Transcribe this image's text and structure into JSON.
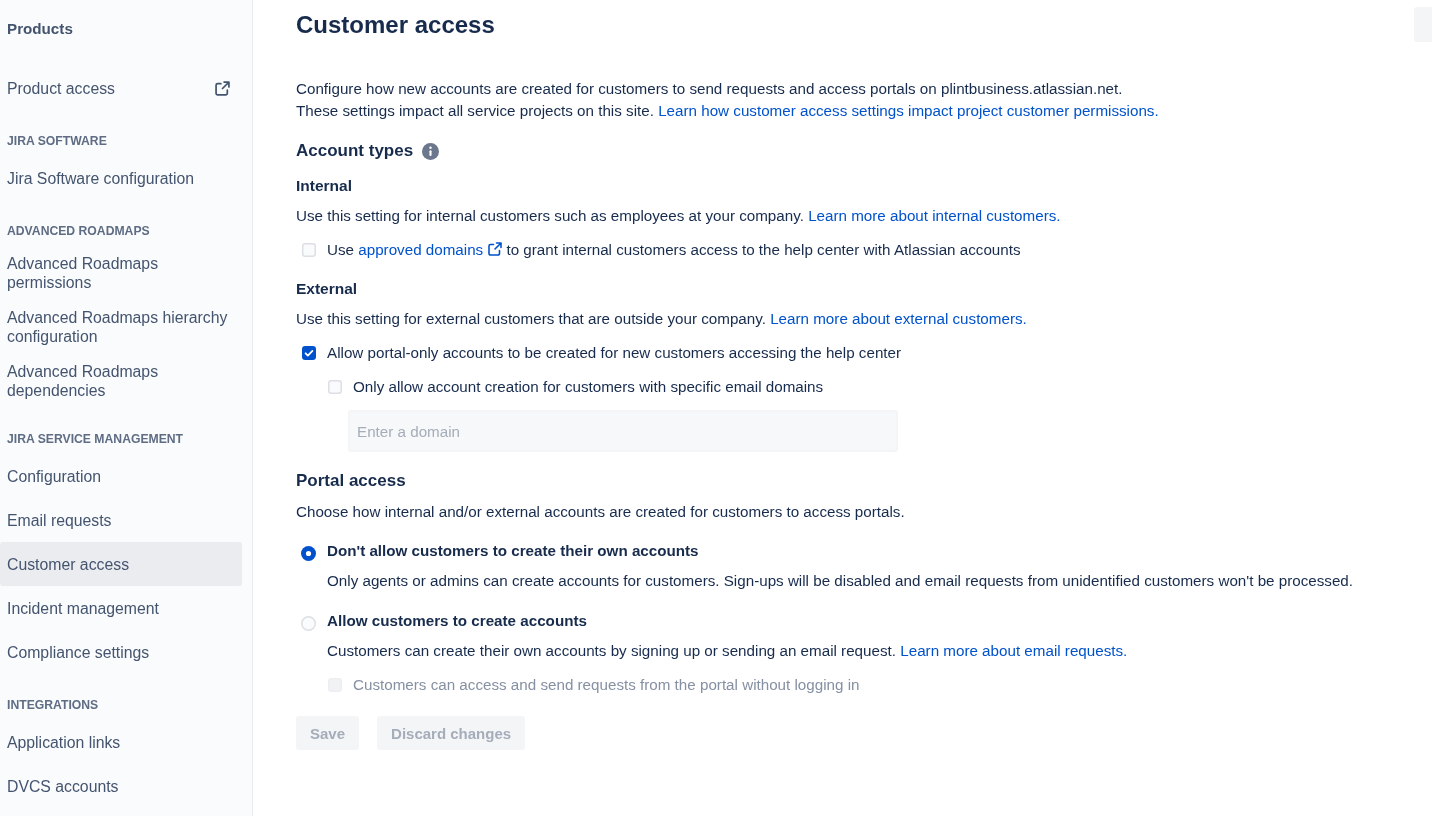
{
  "sidebar": {
    "title": "Products",
    "sections": [
      {
        "items": [
          {
            "label": "Product access",
            "kind": "external",
            "selected": false
          }
        ]
      },
      {
        "heading": "JIRA SOFTWARE",
        "items": [
          {
            "label": "Jira Software configuration",
            "kind": "page",
            "selected": false
          }
        ]
      },
      {
        "heading": "ADVANCED ROADMAPS",
        "items": [
          {
            "label": "Advanced Roadmaps permissions",
            "kind": "page",
            "selected": false
          },
          {
            "label": "Advanced Roadmaps hierarchy configuration",
            "kind": "page",
            "selected": false
          },
          {
            "label": "Advanced Roadmaps dependencies",
            "kind": "page",
            "selected": false
          }
        ]
      },
      {
        "heading": "JIRA SERVICE MANAGEMENT",
        "items": [
          {
            "label": "Configuration",
            "kind": "page",
            "selected": false
          },
          {
            "label": "Email requests",
            "kind": "page",
            "selected": false
          },
          {
            "label": "Customer access",
            "kind": "page",
            "selected": true
          },
          {
            "label": "Incident management",
            "kind": "page",
            "selected": false
          },
          {
            "label": "Compliance settings",
            "kind": "page",
            "selected": false
          }
        ]
      },
      {
        "heading": "INTEGRATIONS",
        "items": [
          {
            "label": "Application links",
            "kind": "page",
            "selected": false
          },
          {
            "label": "DVCS accounts",
            "kind": "page",
            "selected": false
          }
        ]
      }
    ]
  },
  "page": {
    "title": "Customer access",
    "header_actions": [
      {
        "kind": "button"
      }
    ],
    "intro": [
      {
        "text": "Configure how new accounts are created for customers to send requests and access portals on plintbusiness.atlassian.net."
      },
      {
        "text": "These settings impact all service projects on this site.",
        "link": "Learn how customer access settings impact project customer permissions."
      }
    ],
    "sections": [
      {
        "title": "Account types",
        "info": true,
        "groups": [
          {
            "title": "Internal",
            "description": "Use this setting for internal customers such as employees at your company.",
            "link": "Learn more about internal customers.",
            "options": [
              {
                "kind": "checkbox",
                "checked": false,
                "disabled": false,
                "label": "Use",
                "link": "approved domains",
                "label_after": "to grant internal customers access to the help center with Atlassian accounts"
              }
            ]
          },
          {
            "title": "External",
            "description": "Use this setting for external customers that are outside your company.",
            "link": "Learn more about external customers.",
            "options": [
              {
                "kind": "checkbox",
                "checked": true,
                "disabled": false,
                "label": "Allow portal-only accounts to be created for new customers accessing the help center",
                "children": [
                  {
                    "kind": "checkbox",
                    "checked": false,
                    "disabled": false,
                    "label": "Only allow account creation for customers with specific email domains",
                    "children": [
                      {
                        "kind": "field",
                        "placeholder": "Enter a domain"
                      }
                    ]
                  }
                ]
              }
            ]
          }
        ]
      },
      {
        "title": "Portal access",
        "info": false,
        "description": "Choose how internal and/or external accounts are created for customers to access portals.",
        "options": [
          {
            "kind": "radio",
            "selected": true,
            "label": "Don't allow customers to create their own accounts",
            "description": "Only agents or admins can create accounts for customers. Sign-ups will be disabled and email requests from unidentified customers won't be processed."
          },
          {
            "kind": "radio",
            "selected": false,
            "label": "Allow customers to create accounts",
            "description": "Customers can create their own accounts by signing up or sending an email request.",
            "link": "Learn more about email requests.",
            "children": [
              {
                "kind": "checkbox",
                "checked": false,
                "disabled": true,
                "label": "Customers can access and send requests from the portal without logging in"
              }
            ]
          }
        ]
      }
    ],
    "buttons": [
      {
        "label": "Save",
        "disabled": true
      },
      {
        "label": "Discard changes",
        "disabled": true
      }
    ]
  }
}
